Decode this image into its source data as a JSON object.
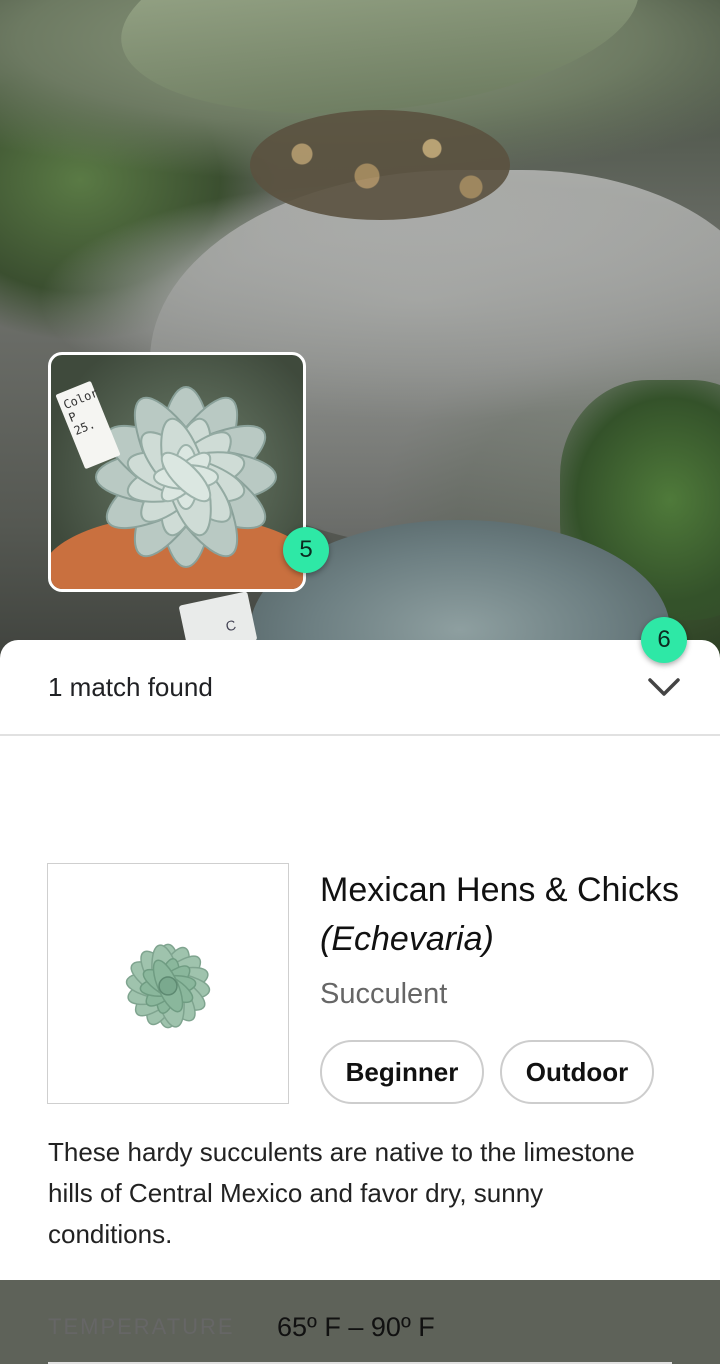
{
  "camera": {
    "tag_text": "C",
    "thumbnail_label": "Color P 25."
  },
  "badges": {
    "thumbnail": "5",
    "collapse": "6"
  },
  "sheet": {
    "match_text": "1 match found",
    "chevron_icon": "chevron-down-icon"
  },
  "result": {
    "name": "Mexican Hens & Chicks",
    "scientific_name": "(Echevaria)",
    "category": "Succulent",
    "tags": [
      "Beginner",
      "Outdoor"
    ],
    "description": "These hardy succulents are native to the limestone hills of Central Mexico and favor dry, sunny conditions.",
    "specs": [
      {
        "label": "TEMPERATURE",
        "value": "65º F – 90º F"
      }
    ]
  },
  "colors": {
    "badge": "#2ee8a6",
    "sheet_bg": "#ffffff",
    "divider": "#e1e1e1"
  }
}
